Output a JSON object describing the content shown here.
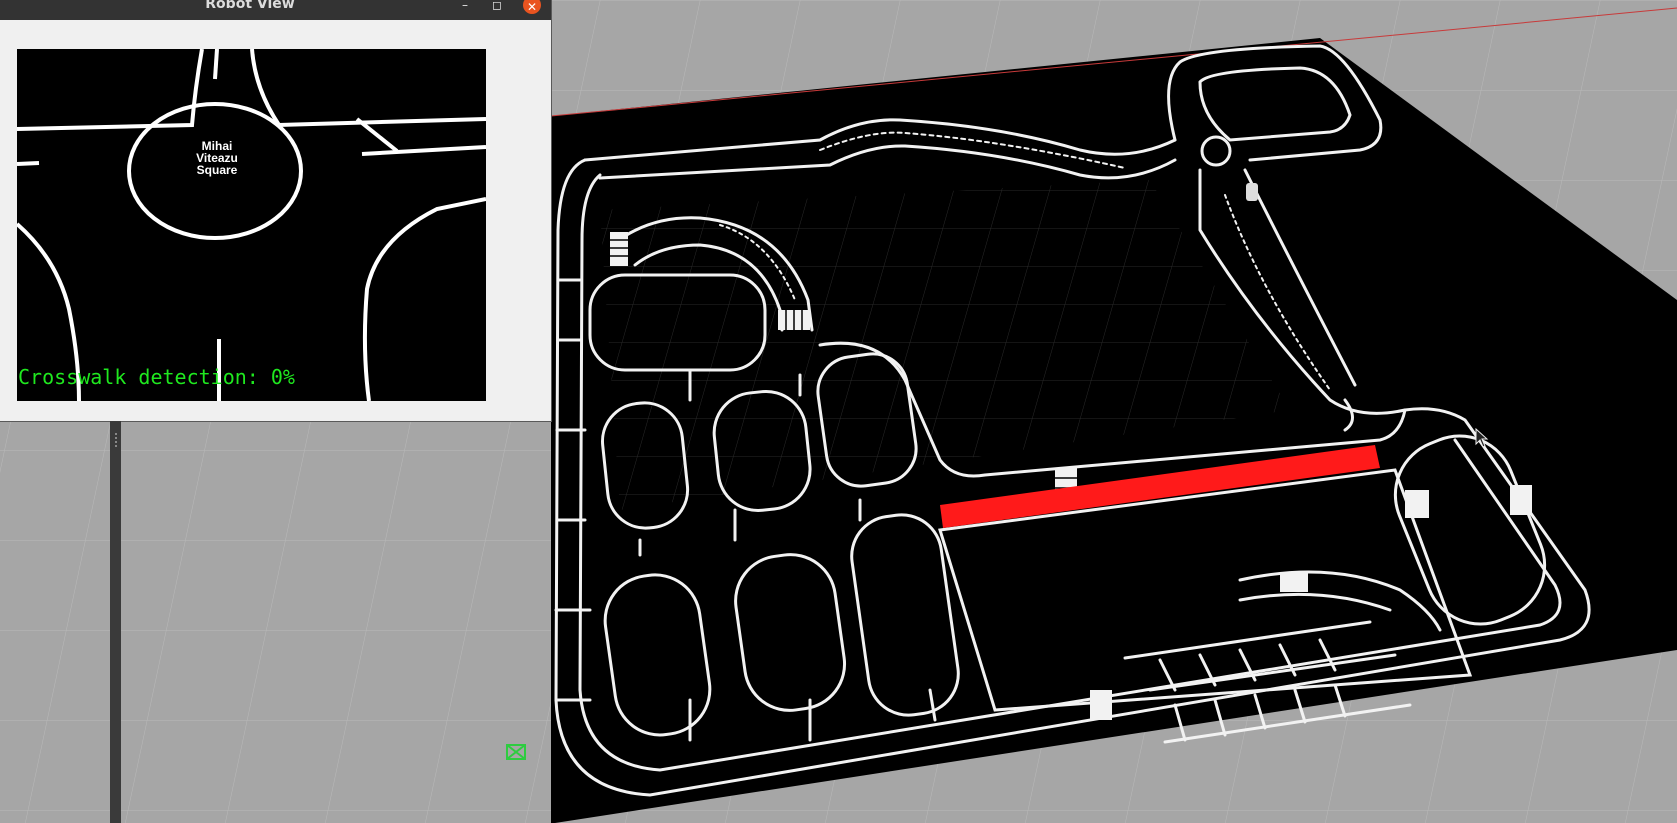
{
  "window": {
    "title": "Robot View",
    "minimize_glyph": "–",
    "maximize_glyph": "◻",
    "close_glyph": "✕"
  },
  "camera": {
    "overlay_text": "Crosswalk detection: 0%",
    "overlay_color": "#1fe81f",
    "sign": {
      "line1": "Mihai",
      "line2": "Viteazu",
      "line3": "Square"
    }
  },
  "scene": {
    "floor_color": "#a6a6a6",
    "track_color": "#000000",
    "lane_color": "#f2f2f2",
    "highlight_color": "#ff1a1a"
  },
  "icons": {
    "cursor": "mouse-pointer-icon",
    "marker": "green-box-icon"
  }
}
